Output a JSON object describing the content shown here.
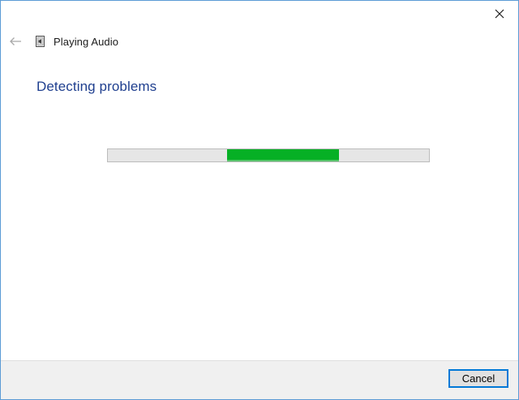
{
  "window": {
    "title": "Playing Audio",
    "close_icon": "close-icon",
    "back_icon": "back-arrow-icon",
    "app_icon": "speaker-document-icon"
  },
  "main": {
    "heading": "Detecting problems",
    "progress": {
      "indeterminate": true,
      "segment_start_fraction": 0.37,
      "segment_end_fraction": 0.72,
      "color": "#06b025"
    }
  },
  "footer": {
    "cancel_label": "Cancel"
  },
  "colors": {
    "heading": "#1f3f8f",
    "accent_border": "#0078d7",
    "window_border": "#5b9bd5"
  }
}
